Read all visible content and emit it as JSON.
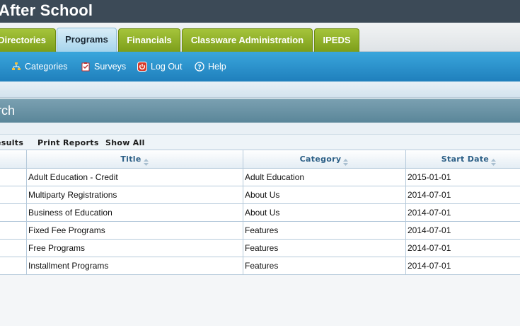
{
  "app": {
    "title": "After School"
  },
  "tabs": [
    {
      "label": "Directories"
    },
    {
      "label": "Programs"
    },
    {
      "label": "Financials"
    },
    {
      "label": "Classware Administration"
    },
    {
      "label": "IPEDS"
    }
  ],
  "subnav": {
    "items": [
      {
        "label": "Categories",
        "icon": "sitemap-icon"
      },
      {
        "label": "Surveys",
        "icon": "clipboard-icon"
      },
      {
        "label": "Log Out",
        "icon": "power-icon"
      },
      {
        "label": "Help",
        "icon": "help-circle-icon"
      }
    ]
  },
  "panel": {
    "title": "rch"
  },
  "toolbar": {
    "results_label": "esults",
    "print_label": "Print Reports",
    "show_all_label": "Show All"
  },
  "grid": {
    "columns": [
      {
        "label": "Title"
      },
      {
        "label": "Category"
      },
      {
        "label": "Start Date"
      }
    ],
    "rows": [
      {
        "title": "Adult Education - Credit",
        "category": "Adult Education",
        "start": "2015-01-01"
      },
      {
        "title": "Multiparty Registrations",
        "category": "About Us",
        "start": "2014-07-01"
      },
      {
        "title": "Business of Education",
        "category": "About Us",
        "start": "2014-07-01"
      },
      {
        "title": "Fixed Fee Programs",
        "category": "Features",
        "start": "2014-07-01"
      },
      {
        "title": "Free Programs",
        "category": "Features",
        "start": "2014-07-01"
      },
      {
        "title": "Installment Programs",
        "category": "Features",
        "start": "2014-07-01"
      }
    ]
  },
  "colors": {
    "topbar": "#3c4a57",
    "tab_green": "#8db22a",
    "nav_blue": "#2a92cc",
    "header_text": "#2c5f86"
  }
}
